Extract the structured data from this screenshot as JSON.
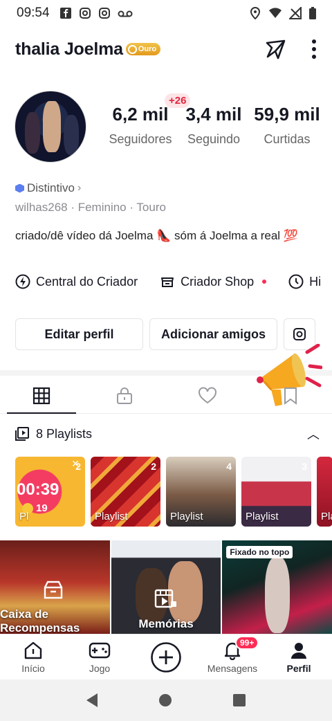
{
  "status_bar": {
    "time": "09:54",
    "left_icons": [
      "facebook-icon",
      "instagram-icon",
      "instagram-icon",
      "voicemail-icon"
    ],
    "right_icons": [
      "location-icon",
      "wifi-icon",
      "signal-icon",
      "battery-icon"
    ]
  },
  "profile": {
    "username": "thalia  Joelma",
    "badge_label": "Ouro",
    "stats": [
      {
        "value": "6,2 mil",
        "label": "Seguidores"
      },
      {
        "value": "3,4 mil",
        "label": "Seguindo"
      },
      {
        "value": "59,9 mil",
        "label": "Curtidas"
      }
    ],
    "new_followers_badge": "+26",
    "distintivo_label": "Distintivo",
    "meta": "wilhas268 · Feminino · Touro",
    "bio": "criado/dê  vídeo dá Joelma 👠 sóm á Joelma a real 💯"
  },
  "creator_row": {
    "items": [
      "Central do Criador",
      "Criador Shop",
      "Hi"
    ]
  },
  "buttons": {
    "edit": "Editar perfil",
    "add_friends": "Adicionar amigos"
  },
  "playlists": {
    "header": "8 Playlists",
    "cards": [
      {
        "count": "2",
        "label": "Pl",
        "timer": "00:39",
        "coins": "19"
      },
      {
        "count": "2",
        "label": "Playlist"
      },
      {
        "count": "4",
        "label": "Playlist"
      },
      {
        "count": "3",
        "label": "Playlist"
      },
      {
        "count": "",
        "label": "Pla"
      }
    ]
  },
  "grid": {
    "cells": [
      {
        "caption": "Caixa de Recompensas"
      },
      {
        "caption": "Memórias"
      },
      {
        "caption": "",
        "pinned": "Fixado no topo"
      }
    ]
  },
  "bottom_nav": {
    "items": [
      "Início",
      "Jogo",
      "",
      "Mensagens",
      "Perfil"
    ],
    "notification_badge": "99+"
  },
  "colors": {
    "accent": "#fe2c55",
    "gold": "#e8a52a"
  }
}
